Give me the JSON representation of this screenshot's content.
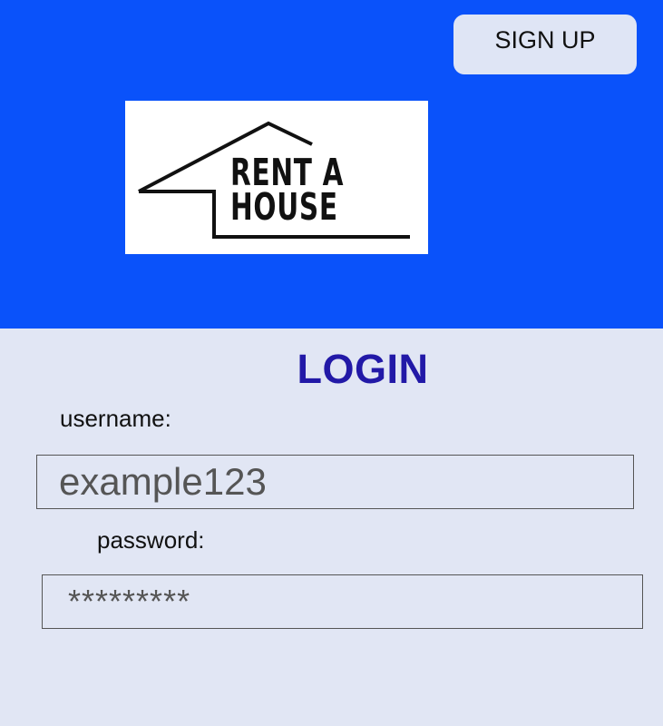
{
  "header": {
    "signup_label": "SIGN UP",
    "accent_color": "#0a52fa"
  },
  "logo": {
    "line1": "RENT A",
    "line2": "HOUSE",
    "icon": "house-outline-icon"
  },
  "login": {
    "title": "LOGIN",
    "title_color": "#2219a7",
    "username_label": "username:",
    "username_value": "example123",
    "password_label": "password:",
    "password_value": "*********"
  }
}
